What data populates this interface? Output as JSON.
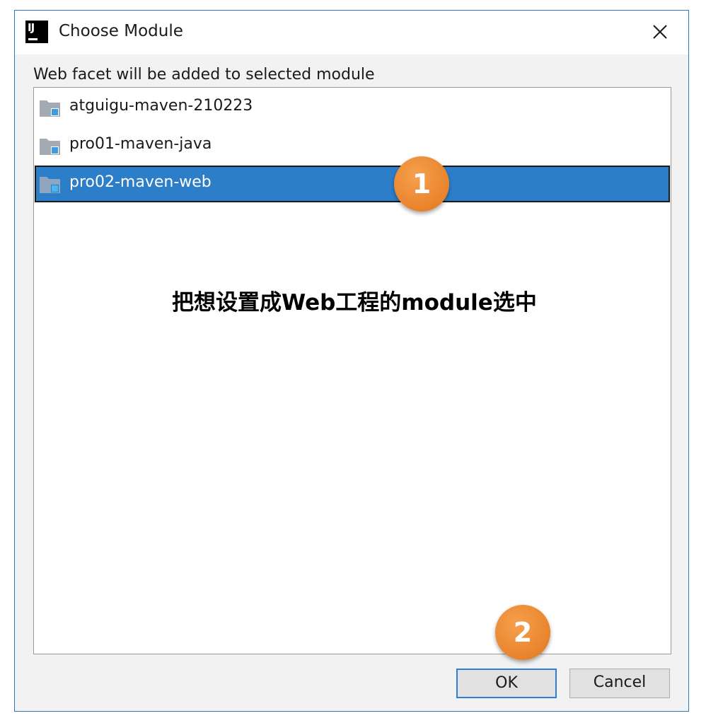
{
  "window": {
    "title": "Choose Module",
    "logo_text": "IJ"
  },
  "prompt": "Web facet will be added to selected module",
  "modules": [
    {
      "label": "atguigu-maven-210223",
      "selected": false
    },
    {
      "label": "pro01-maven-java",
      "selected": false
    },
    {
      "label": "pro02-maven-web",
      "selected": true
    }
  ],
  "annotations": {
    "instruction": "把想设置成Web工程的module选中",
    "step1": "1",
    "step2": "2"
  },
  "buttons": {
    "ok": "OK",
    "cancel": "Cancel"
  },
  "colors": {
    "selection": "#2d7ec9",
    "badge": "#e9832b",
    "border_accent": "#2f74c8"
  }
}
